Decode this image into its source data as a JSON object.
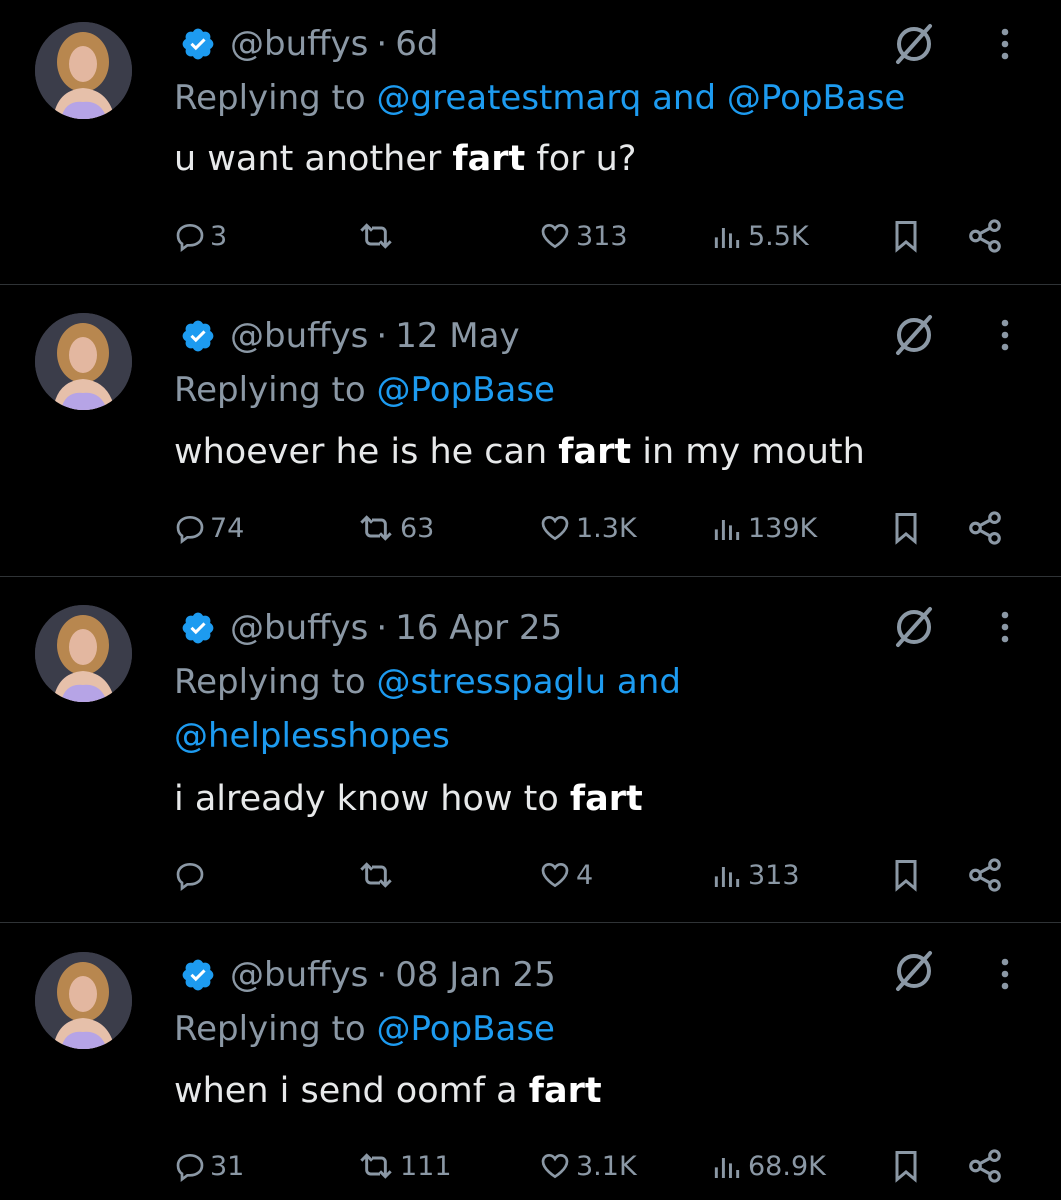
{
  "colors": {
    "background": "#000000",
    "text": "#e7e9ea",
    "muted": "#8b98a5",
    "link": "#1d9bf0",
    "divider": "#2f3336"
  },
  "icons": [
    "verified-badge-icon",
    "slash-circle-icon",
    "more-vertical-icon",
    "reply-icon",
    "retweet-icon",
    "like-icon",
    "views-icon",
    "bookmark-icon",
    "share-icon"
  ],
  "tweets": [
    {
      "handle": "@buffys",
      "separator": "·",
      "time": "6d",
      "replying_prefix": "Replying to ",
      "mentions_line1": [
        "@greatestmarq",
        " and ",
        "@PopBase"
      ],
      "mentions_line2": "",
      "text_before": "u want another ",
      "text_bold": "fart",
      "text_after": " for u?",
      "replies": "3",
      "retweets": "",
      "likes": "313",
      "views": "5.5K"
    },
    {
      "handle": "@buffys",
      "separator": "·",
      "time": "12 May",
      "replying_prefix": "Replying to ",
      "mentions_line1": [
        "@PopBase",
        "",
        ""
      ],
      "mentions_line2": "",
      "text_before": "whoever he is he can ",
      "text_bold": "fart",
      "text_after": " in my mouth",
      "replies": "74",
      "retweets": "63",
      "likes": "1.3K",
      "views": "139K"
    },
    {
      "handle": "@buffys",
      "separator": "·",
      "time": "16 Apr 25",
      "replying_prefix": "Replying to ",
      "mentions_line1": [
        "@stresspaglu",
        " and",
        ""
      ],
      "mentions_line2": "@helplesshopes",
      "text_before": "i already know how to ",
      "text_bold": "fart",
      "text_after": "",
      "replies": "",
      "retweets": "",
      "likes": "4",
      "views": "313"
    },
    {
      "handle": "@buffys",
      "separator": "·",
      "time": "08 Jan 25",
      "replying_prefix": "Replying to ",
      "mentions_line1": [
        "@PopBase",
        "",
        ""
      ],
      "mentions_line2": "",
      "text_before": "when i send oomf a ",
      "text_bold": "fart",
      "text_after": "",
      "replies": "31",
      "retweets": "111",
      "likes": "3.1K",
      "views": "68.9K"
    }
  ]
}
